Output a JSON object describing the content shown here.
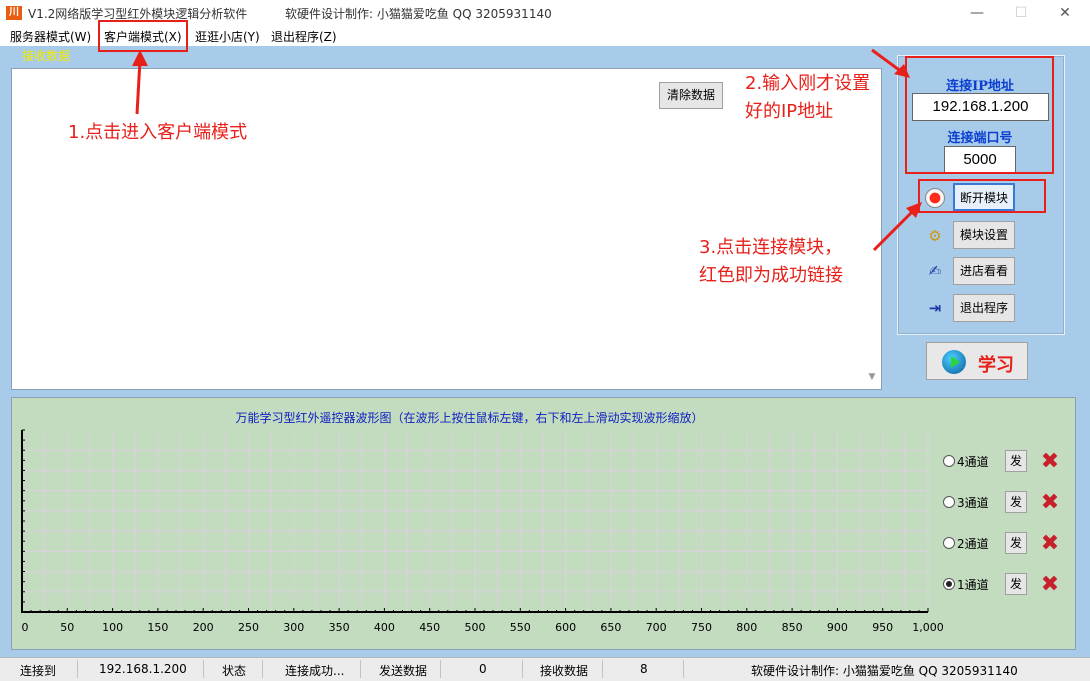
{
  "window": {
    "icon_text": "川",
    "title": "V1.2网络版学习型红外模块逻辑分析软件",
    "credit": "软硬件设计制作:  小猫猫爱吃鱼  QQ 3205931140",
    "minimize": "—",
    "maximize": "☐",
    "close": "✕"
  },
  "menu": {
    "items": [
      "服务器模式(W)",
      "客户端模式(X)",
      "逛逛小店(Y)",
      "退出程序(Z)"
    ]
  },
  "receive": {
    "label": "接收数据",
    "clear_label": "清除数据"
  },
  "connection": {
    "ip_label": "连接IP地址",
    "ip_value": "192.168.1.200",
    "port_label": "连接端口号",
    "port_value": "5000"
  },
  "side_buttons": {
    "disconnect": "断开模块",
    "settings": "模块设置",
    "shop": "进店看看",
    "exit": "退出程序"
  },
  "learn_label": "学习",
  "wave": {
    "title": "万能学习型红外遥控器波形图（在波形上按住鼠标左键，右下和左上滑动实现波形缩放）"
  },
  "channels": [
    {
      "label": "4通道",
      "selected": false,
      "send": "发"
    },
    {
      "label": "3通道",
      "selected": false,
      "send": "发"
    },
    {
      "label": "2通道",
      "selected": false,
      "send": "发"
    },
    {
      "label": "1通道",
      "selected": true,
      "send": "发"
    }
  ],
  "chart_data": {
    "type": "line",
    "xlim": [
      0,
      1000
    ],
    "x_ticks": [
      "0",
      "50",
      "100",
      "150",
      "200",
      "250",
      "300",
      "350",
      "400",
      "450",
      "500",
      "550",
      "600",
      "650",
      "700",
      "750",
      "800",
      "850",
      "900",
      "950",
      "1,000"
    ],
    "grid": true,
    "series": []
  },
  "status": {
    "connect_to_label": "连接到",
    "connect_to_value": "192.168.1.200",
    "state_label": "状态",
    "state_value": "连接成功...",
    "sent_label": "发送数据",
    "sent_value": "0",
    "recv_label": "接收数据",
    "recv_value": "8",
    "credit": "软硬件设计制作:  小猫猫爱吃鱼  QQ 3205931140"
  },
  "annotations": {
    "step1": "1.点击进入客户端模式",
    "step2_line1": "2.输入刚才设置",
    "step2_line2": "好的IP地址",
    "step3_line1": "3.点击连接模块，",
    "step3_line2": "红色即为成功链接"
  },
  "colors": {
    "annotation": "#e8201a",
    "panel_label": "#0a3fd0",
    "recv_label": "#f2ea00",
    "background": "#a9cbea",
    "wave_bg": "#c3dcc0"
  }
}
